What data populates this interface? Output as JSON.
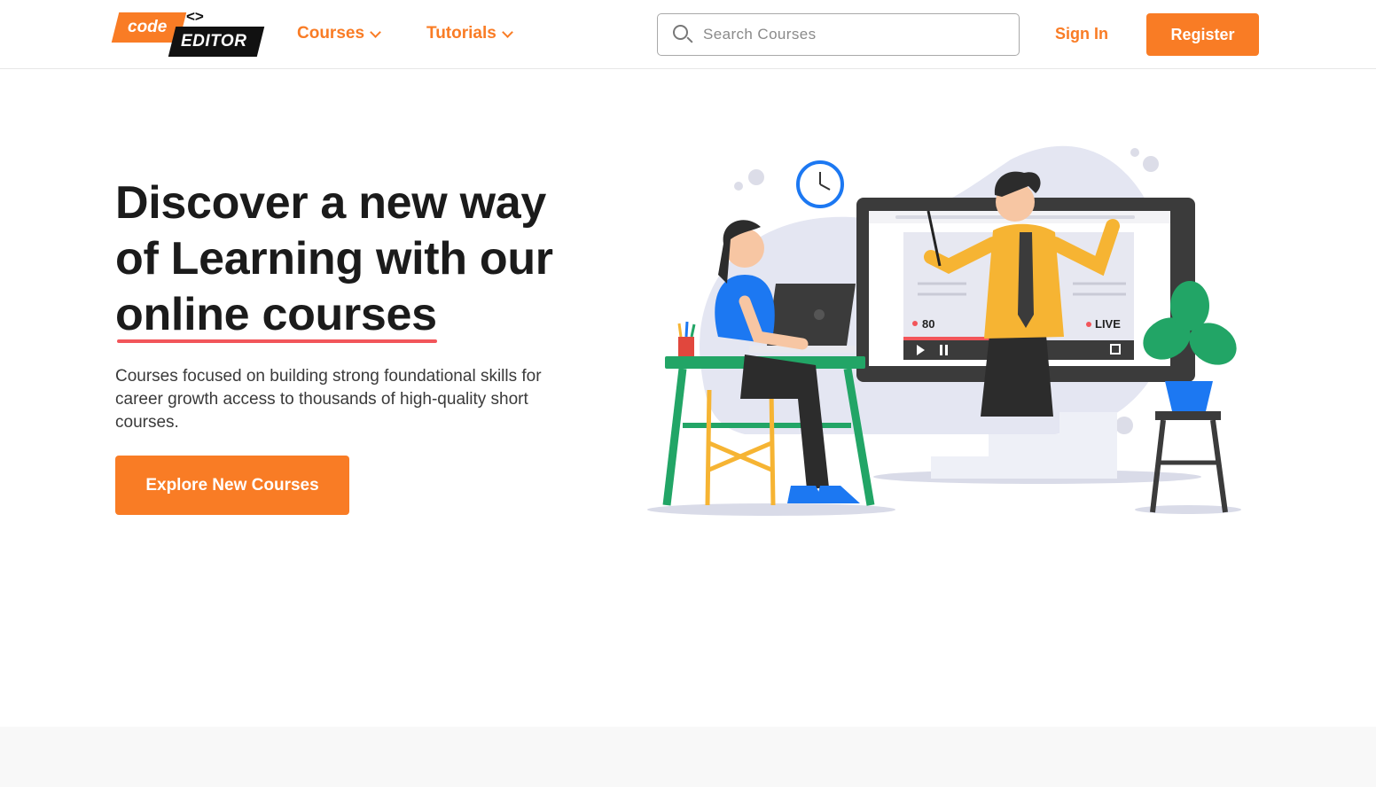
{
  "logo": {
    "code_text": "code",
    "editor_text": "EDITOR",
    "brackets": "<>"
  },
  "nav": {
    "courses_label": "Courses",
    "tutorials_label": "Tutorials"
  },
  "search": {
    "placeholder": "Search Courses",
    "icon": "search-icon"
  },
  "auth": {
    "signin_label": "Sign In",
    "register_label": "Register"
  },
  "hero": {
    "title_line1": "Discover a new way",
    "title_line2": "of Learning with our",
    "title_highlight": "online courses",
    "description": "Courses focused on building strong foundational skills for career growth access to thousands of high-quality short courses.",
    "cta_label": "Explore New Courses"
  },
  "illustration": {
    "viewer_count": "80",
    "live_label": "LIVE"
  },
  "colors": {
    "accent": "#f97c25",
    "underline": "#f2555a",
    "text": "#1b1b1b"
  }
}
